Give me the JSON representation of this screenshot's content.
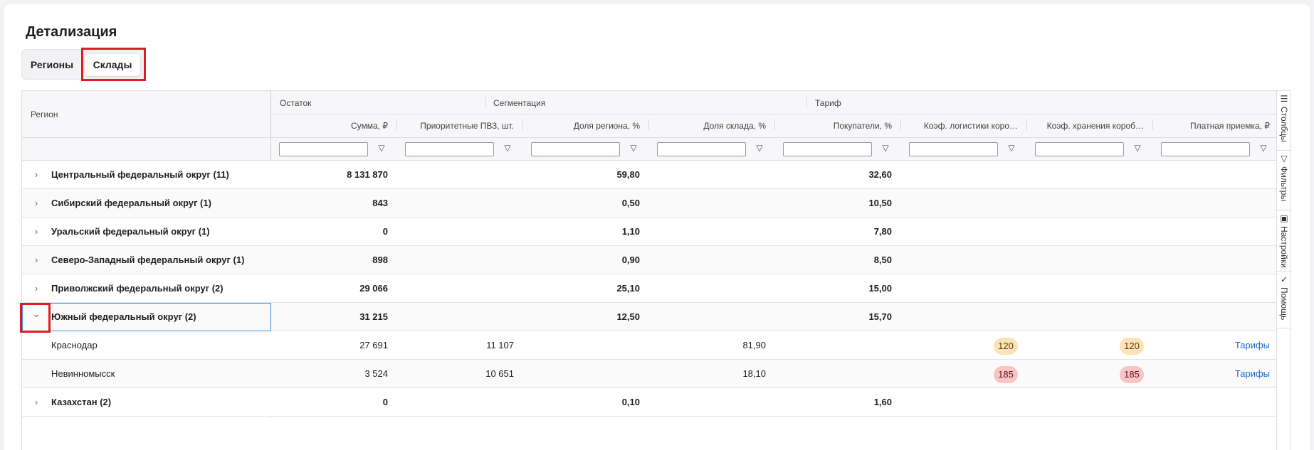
{
  "page": {
    "title": "Детализация"
  },
  "tabs": [
    {
      "label": "Регионы",
      "active": false
    },
    {
      "label": "Склады",
      "active": true
    }
  ],
  "grid": {
    "region_header": "Регион",
    "groups": [
      "Остаток",
      "Сегментация",
      "Тариф"
    ],
    "columns": [
      "Сумма, ₽",
      "Приоритетные ПВЗ, шт.",
      "Доля региона, %",
      "Доля склада, %",
      "Покупатели, %",
      "Коэф. логистики коро…",
      "Коэф. хранения короб…",
      "Платная приемка, ₽"
    ],
    "rows": [
      {
        "name": "Центральный федеральный округ (11)",
        "level": 0,
        "expanded": false,
        "values": [
          "8 131 870",
          "",
          "59,80",
          "",
          "32,60",
          "",
          "",
          ""
        ]
      },
      {
        "name": "Сибирский федеральный округ (1)",
        "level": 0,
        "expanded": false,
        "values": [
          "843",
          "",
          "0,50",
          "",
          "10,50",
          "",
          "",
          ""
        ]
      },
      {
        "name": "Уральский федеральный округ (1)",
        "level": 0,
        "expanded": false,
        "values": [
          "0",
          "",
          "1,10",
          "",
          "7,80",
          "",
          "",
          ""
        ]
      },
      {
        "name": "Северо-Западный федеральный округ (1)",
        "level": 0,
        "expanded": false,
        "values": [
          "898",
          "",
          "0,90",
          "",
          "8,50",
          "",
          "",
          ""
        ]
      },
      {
        "name": "Приволжский федеральный округ (2)",
        "level": 0,
        "expanded": false,
        "values": [
          "29 066",
          "",
          "25,10",
          "",
          "15,00",
          "",
          "",
          ""
        ]
      },
      {
        "name": "Южный федеральный округ (2)",
        "level": 0,
        "expanded": true,
        "values": [
          "31 215",
          "",
          "12,50",
          "",
          "15,70",
          "",
          "",
          ""
        ]
      },
      {
        "name": "Краснодар",
        "level": 1,
        "values": [
          "27 691",
          "11 107",
          "",
          "81,90",
          "",
          "120",
          "120",
          "Тарифы"
        ],
        "badge_color": "orange"
      },
      {
        "name": "Невинномысск",
        "level": 1,
        "values": [
          "3 524",
          "10 651",
          "",
          "18,10",
          "",
          "185",
          "185",
          "Тарифы"
        ],
        "badge_color": "red"
      },
      {
        "name": "Казахстан (2)",
        "level": 0,
        "expanded": false,
        "values": [
          "0",
          "",
          "0,10",
          "",
          "1,60",
          "",
          "",
          ""
        ]
      }
    ]
  },
  "side_panel": [
    {
      "label": "Столбцы",
      "icon": "columns-icon"
    },
    {
      "label": "Фильтры",
      "icon": "filter-icon"
    },
    {
      "label": "Настройки",
      "icon": "settings-icon"
    },
    {
      "label": "Помощь",
      "icon": "help-icon"
    }
  ],
  "colors": {
    "accent": "#1a6bc7",
    "highlight": "#e01b24",
    "badge_orange": "#fde4b8",
    "badge_red": "#f8c4c4"
  }
}
